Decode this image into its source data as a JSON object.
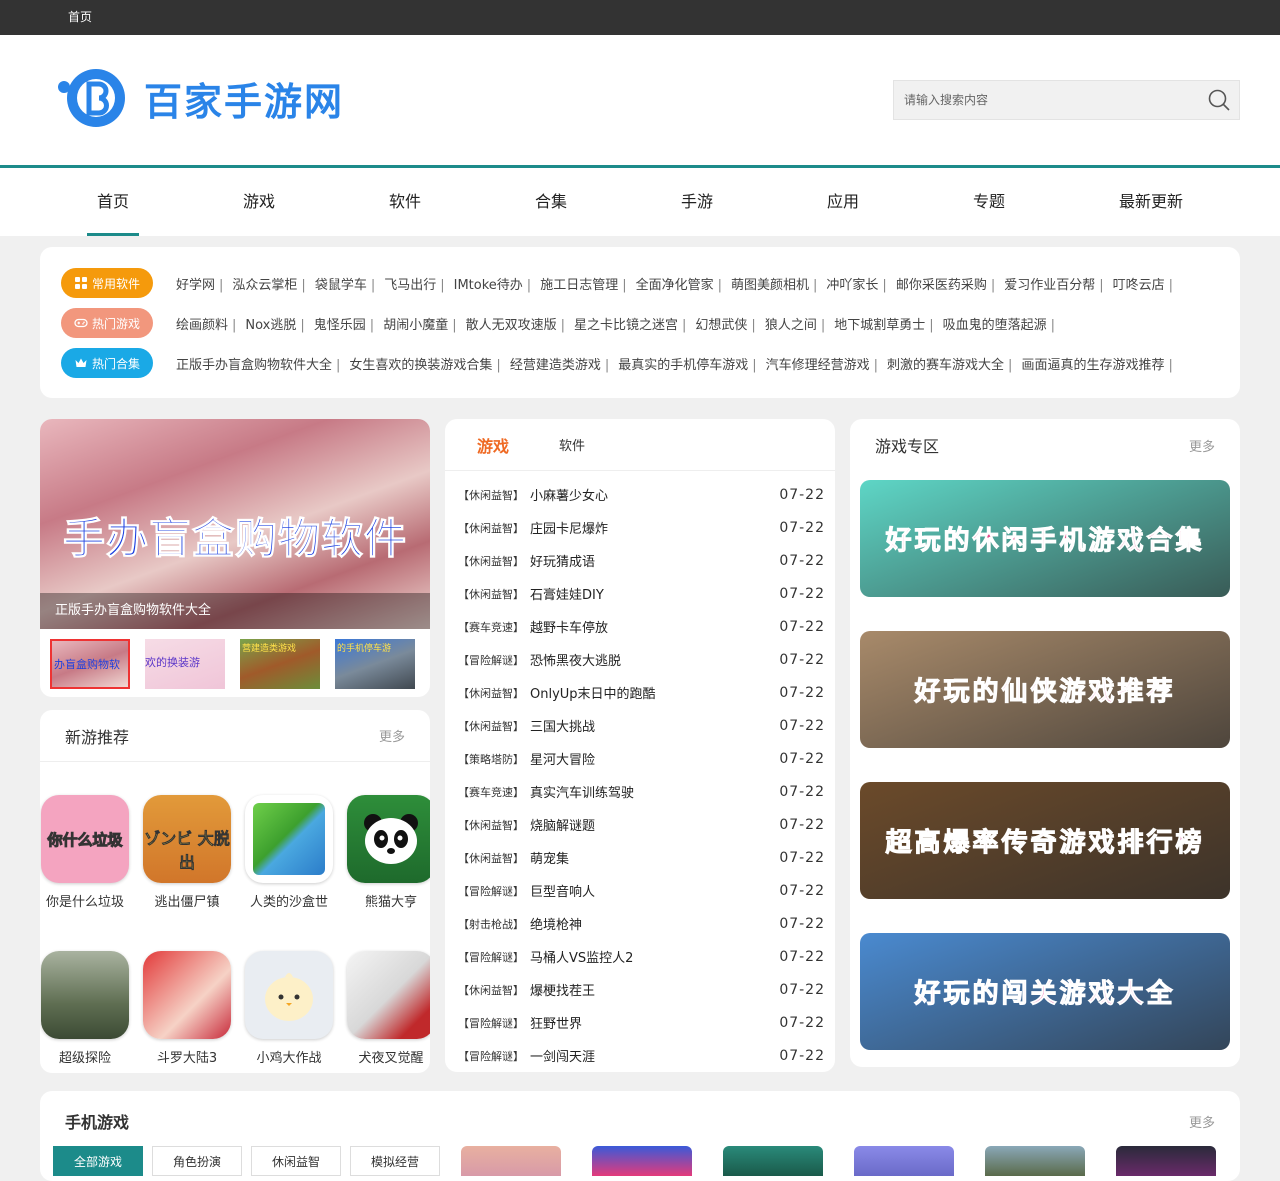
{
  "topbar": {
    "home": "首页"
  },
  "header": {
    "logo_text": "百家手游网",
    "search_placeholder": "请输入搜索内容"
  },
  "nav": {
    "items": [
      "首页",
      "游戏",
      "软件",
      "合集",
      "手游",
      "应用",
      "专题",
      "最新更新"
    ]
  },
  "tags": {
    "rows": [
      {
        "label": "常用软件",
        "color": "#f59a0c",
        "icon": "grid-icon",
        "links": [
          "好学网",
          "泓众云掌柜",
          "袋鼠学车",
          "飞马出行",
          "IMtoke待办",
          "施工日志管理",
          "全面净化管家",
          "萌图美颜相机",
          "冲吖家长",
          "邮你采医药采购",
          "爱习作业百分帮",
          "叮咚云店"
        ]
      },
      {
        "label": "热门游戏",
        "color": "#f2977d",
        "icon": "gamepad-icon",
        "links": [
          "绘画颜料",
          "Nox逃脱",
          "鬼怪乐园",
          "胡闹小魔童",
          "散人无双攻速版",
          "星之卡比镜之迷宫",
          "幻想武侠",
          "狼人之间",
          "地下城割草勇士",
          "吸血鬼的堕落起源"
        ]
      },
      {
        "label": "热门合集",
        "color": "#1aa9e6",
        "icon": "crown-icon",
        "links": [
          "正版手办盲盒购物软件大全",
          "女生喜欢的换装游戏合集",
          "经营建造类游戏",
          "最真实的手机停车游戏",
          "汽车修理经营游戏",
          "刺激的赛车游戏大全",
          "画面逼真的生存游戏推荐"
        ]
      }
    ]
  },
  "slider": {
    "main_text": "手办盲盒购物软件",
    "caption": "正版手办盲盒购物软件大全",
    "thumbs": [
      "办盲盒购物软",
      "欢的换装游",
      "营建造类游戏",
      "的手机停车游"
    ]
  },
  "new_games": {
    "title": "新游推荐",
    "more": "更多",
    "apps": [
      "你是什么垃圾",
      "逃出僵尸镇",
      "人类的沙盒世",
      "熊猫大亨",
      "超级探险",
      "斗罗大陆3",
      "小鸡大作战",
      "犬夜叉觉醒"
    ],
    "icon_texts": [
      "你什么垃圾",
      "ゾンビ 大脱出"
    ]
  },
  "list_panel": {
    "tabs": [
      "游戏",
      "软件"
    ],
    "items": [
      {
        "cat": "【休闲益智】",
        "title": "小麻薯少女心",
        "date": "07-22"
      },
      {
        "cat": "【休闲益智】",
        "title": "庄园卡尼爆炸",
        "date": "07-22"
      },
      {
        "cat": "【休闲益智】",
        "title": "好玩猜成语",
        "date": "07-22"
      },
      {
        "cat": "【休闲益智】",
        "title": "石膏娃娃DIY",
        "date": "07-22"
      },
      {
        "cat": "【赛车竞速】",
        "title": "越野卡车停放",
        "date": "07-22"
      },
      {
        "cat": "【冒险解谜】",
        "title": "恐怖黑夜大逃脱",
        "date": "07-22"
      },
      {
        "cat": "【休闲益智】",
        "title": "OnlyUp末日中的跑酷",
        "date": "07-22"
      },
      {
        "cat": "【休闲益智】",
        "title": "三国大挑战",
        "date": "07-22"
      },
      {
        "cat": "【策略塔防】",
        "title": "星河大冒险",
        "date": "07-22"
      },
      {
        "cat": "【赛车竞速】",
        "title": "真实汽车训练驾驶",
        "date": "07-22"
      },
      {
        "cat": "【休闲益智】",
        "title": "烧脑解谜题",
        "date": "07-22"
      },
      {
        "cat": "【休闲益智】",
        "title": "萌宠集",
        "date": "07-22"
      },
      {
        "cat": "【冒险解谜】",
        "title": "巨型音响人",
        "date": "07-22"
      },
      {
        "cat": "【射击枪战】",
        "title": "绝境枪神",
        "date": "07-22"
      },
      {
        "cat": "【冒险解谜】",
        "title": "马桶人VS监控人2",
        "date": "07-22"
      },
      {
        "cat": "【休闲益智】",
        "title": "爆梗找茬王",
        "date": "07-22"
      },
      {
        "cat": "【冒险解谜】",
        "title": "狂野世界",
        "date": "07-22"
      },
      {
        "cat": "【冒险解谜】",
        "title": "一剑闯天涯",
        "date": "07-22"
      }
    ]
  },
  "zone": {
    "title": "游戏专区",
    "more": "更多",
    "banners": [
      {
        "text": "好玩的休闲手机游戏合集",
        "bg": "#5ed6c6",
        "fg": "#e34b8a"
      },
      {
        "text": "好玩的仙侠游戏推荐",
        "bg": "#a88a6a",
        "fg": "#f05aa8"
      },
      {
        "text": "超高爆率传奇游戏排行榜",
        "bg": "#6b4a2a",
        "fg": "#f0b8d8"
      },
      {
        "text": "好玩的闯关游戏大全",
        "bg": "#4a8ad0",
        "fg": "#f05aa8"
      }
    ]
  },
  "mobile": {
    "title": "手机游戏",
    "more": "更多",
    "tabs": [
      "全部游戏",
      "角色扮演",
      "休闲益智",
      "模拟经营"
    ]
  }
}
